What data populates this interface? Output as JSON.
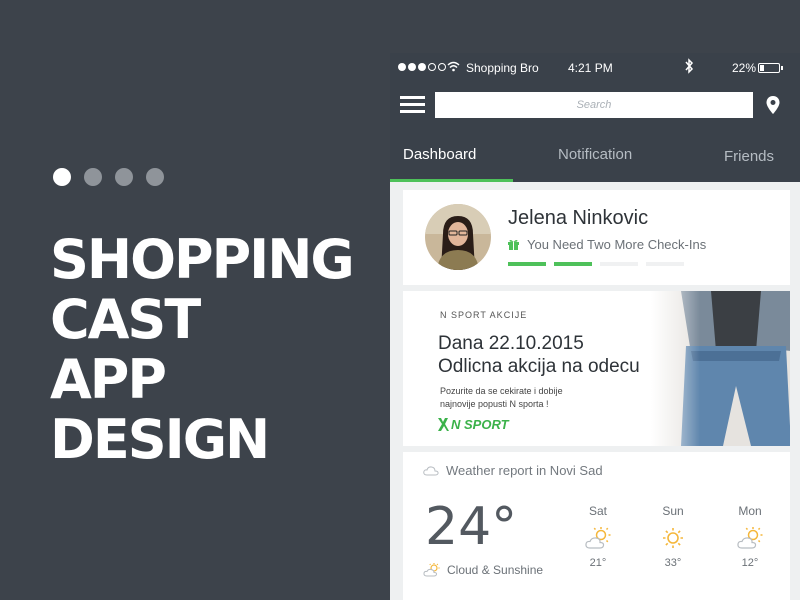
{
  "promo": {
    "headline": [
      "SHOPPING",
      "CAST",
      "APP",
      "DESIGN"
    ],
    "slides_total": 4,
    "active_slide": 1
  },
  "status_bar": {
    "carrier": "Shopping Bro",
    "time": "4:21 PM",
    "battery": "22%",
    "battery_level": 0.22
  },
  "nav": {
    "search_placeholder": "Search"
  },
  "tabs": [
    {
      "label": "Dashboard",
      "active": true
    },
    {
      "label": "Notification",
      "active": false
    },
    {
      "label": "Friends",
      "active": false
    }
  ],
  "profile": {
    "name": "Jelena Ninkovic",
    "checkin_message": "You Need Two More Check-Ins",
    "progress_completed": 2,
    "progress_total": 4
  },
  "promo_card": {
    "label": "N SPORT AKCIJE",
    "title_line1": "Dana 22.10.2015",
    "title_line2": "Odlicna akcija na odecu",
    "desc_line1": "Pozurite da se cekirate i dobije",
    "desc_line2": "najnovije popusti N sporta !",
    "brand": "N SPORT"
  },
  "weather": {
    "title": "Weather report in Novi Sad",
    "temperature": "24°",
    "condition": "Cloud & Sunshine",
    "forecast": [
      {
        "day": "Sat",
        "temp": "21°",
        "icon": "partly-cloudy-icon"
      },
      {
        "day": "Sun",
        "temp": "33°",
        "icon": "sun-icon"
      },
      {
        "day": "Mon",
        "temp": "12°",
        "icon": "partly-cloudy-icon"
      }
    ]
  },
  "colors": {
    "background": "#3d434b",
    "app_header": "#3a414a",
    "accent_green": "#4ec15a",
    "sun_yellow": "#f5b73b"
  }
}
